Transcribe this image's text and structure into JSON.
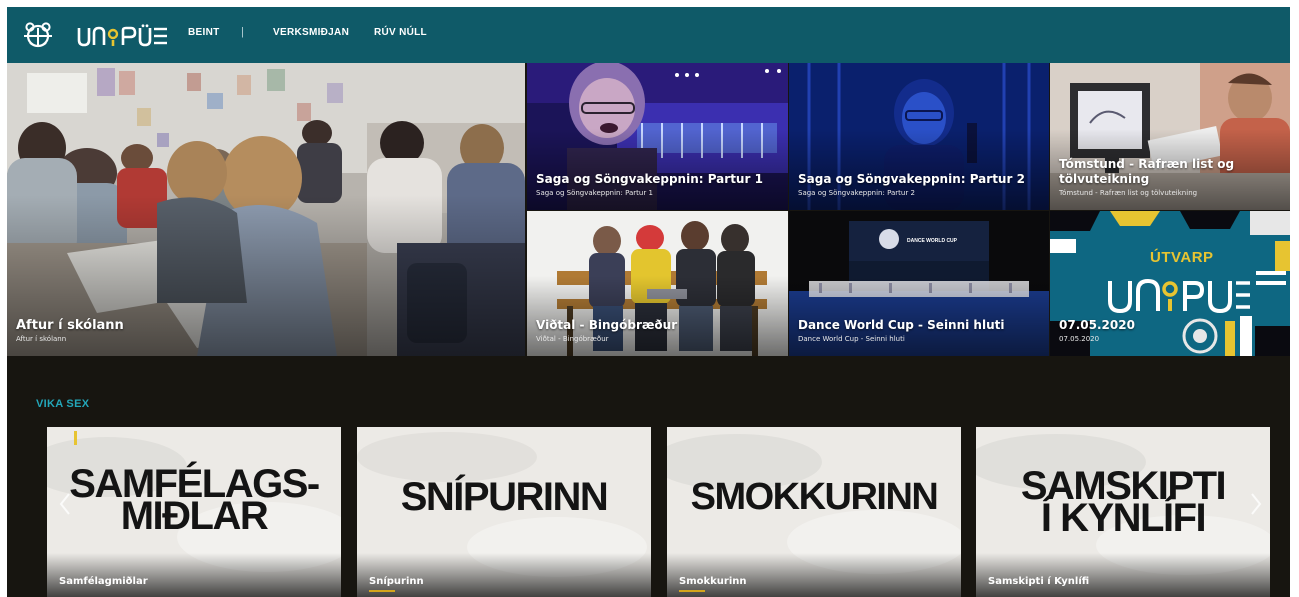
{
  "nav": {
    "logo_icon": "bear-emblem-icon",
    "brand_logo": "ungruv-wordmark",
    "links": [
      {
        "label": "BEINT"
      },
      {
        "label": "VERKSMIÐJAN"
      },
      {
        "label": "RÚV NÚLL"
      }
    ],
    "separator": "|"
  },
  "featured": {
    "main": {
      "title": "Aftur í skólann",
      "subtitle": "Aftur í skólann"
    },
    "tiles": [
      {
        "title": "Saga og Söngvakeppnin: Partur 1",
        "subtitle": "Saga og Söngvakeppnin: Partur 1"
      },
      {
        "title": "Saga og Söngvakeppnin: Partur 2",
        "subtitle": "Saga og Söngvakeppnin: Partur 2"
      },
      {
        "title": "Tómstund - Rafræn list og tölvuteikning",
        "subtitle": "Tómstund - Rafræn list og tölvuteikning"
      },
      {
        "title": "Viðtal - Bingóbræður",
        "subtitle": "Viðtal - Bingóbræður"
      },
      {
        "title": "Dance World Cup - Seinni hluti",
        "subtitle": "Dance World Cup - Seinni hluti"
      },
      {
        "title": "07.05.2020",
        "subtitle": "07.05.2020"
      }
    ],
    "dance_banner_text": "DANCE WORLD CUP",
    "utvarp_label": "ÚTVARP"
  },
  "section": {
    "title": "VIKA SEX",
    "cards": [
      {
        "line1": "SAMFÉLAGS-",
        "line2": "MIÐLAR",
        "label": "Samfélagmiðlar"
      },
      {
        "line1": "SNÍPURINN",
        "line2": "",
        "label": "Snípurinn"
      },
      {
        "line1": "SMOKKURINN",
        "line2": "",
        "label": "Smokkurinn"
      },
      {
        "line1": "SAMSKIPTI",
        "line2": "Í KYNLÍFI",
        "label": "Samskipti í Kynlífi"
      }
    ],
    "prev_icon": "chevron-left-icon",
    "next_icon": "chevron-right-icon"
  },
  "colors": {
    "nav_bg": "#0f5a68",
    "page_bg": "#171510",
    "section_title": "#23a6b9",
    "card_bg": "#ecebe8",
    "accent_yellow": "#d4a51c"
  }
}
